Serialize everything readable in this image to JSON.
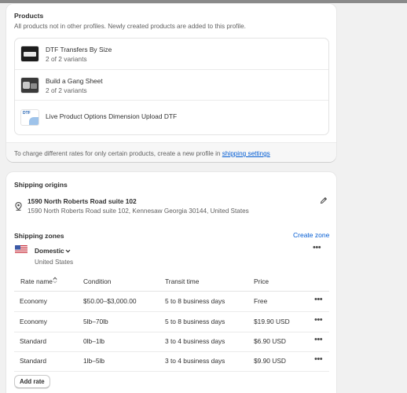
{
  "products_card": {
    "title": "Products",
    "description": "All products not in other profiles. Newly created products are added to this profile.",
    "items": [
      {
        "name": "DTF Transfers By Size",
        "variants": "2 of 2 variants"
      },
      {
        "name": "Build a Gang Sheet",
        "variants": "2 of 2 variants"
      },
      {
        "name": "Live Product Options Dimension Upload DTF",
        "variants": ""
      }
    ],
    "thumb_dtf_label": "DTF",
    "footer_text": "To charge different rates for only certain products, create a new profile in",
    "footer_link": "shipping settings"
  },
  "shipping_origins": {
    "title": "Shipping origins",
    "name": "1590 North Roberts Road suite 102",
    "address": "1590 North Roberts Road suite 102, Kennesaw Georgia 30144, United States"
  },
  "shipping_zones": {
    "title": "Shipping zones",
    "create_zone": "Create zone",
    "zone_name": "Domestic",
    "zone_country": "United States",
    "columns": [
      "Rate name",
      "Condition",
      "Transit time",
      "Price"
    ],
    "rates": [
      {
        "name": "Economy",
        "condition": "$50.00–$3,000.00",
        "transit": "5 to 8 business days",
        "price": "Free"
      },
      {
        "name": "Economy",
        "condition": "5lb–70lb",
        "transit": "5 to 8 business days",
        "price": "$19.90 USD"
      },
      {
        "name": "Standard",
        "condition": "0lb–1lb",
        "transit": "3 to 4 business days",
        "price": "$6.90 USD"
      },
      {
        "name": "Standard",
        "condition": "1lb–5lb",
        "transit": "3 to 4 business days",
        "price": "$9.90 USD"
      }
    ],
    "add_rate": "Add rate",
    "more_glyph": "•••"
  },
  "colors": {
    "link": "#005bd3",
    "text": "#303030",
    "muted": "#616161",
    "background": "#f1f1f1"
  }
}
